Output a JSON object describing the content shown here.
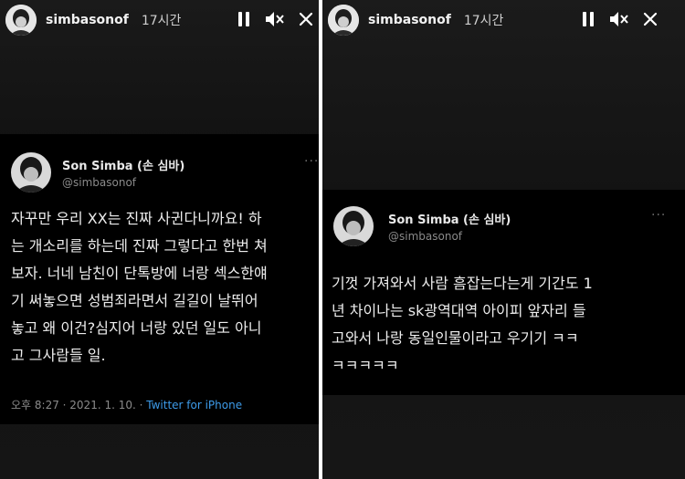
{
  "stories": [
    {
      "username": "simbasonof",
      "time_ago": "17시간",
      "tweet": {
        "display_name": "Son Simba (손 심바)",
        "handle": "@simbasonof",
        "more_label": "···",
        "lines": [
          "자꾸만 우리 XX는 진짜 사귄다니까요! 하",
          "는 개소리를 하는데 진짜 그렇다고 한번 쳐",
          "보자. 너네 남친이 단톡방에 너랑 섹스한얘",
          "기 써놓으면 성범죄라면서 길길이 날뛰어",
          "놓고 왜 이건?심지어 너랑 있던 일도 아니",
          "고 그사람들 일."
        ],
        "timestamp": "오후 8:27 · 2021. 1. 10. · ",
        "source": "Twitter for iPhone"
      }
    },
    {
      "username": "simbasonof",
      "time_ago": "17시간",
      "tweet": {
        "display_name": "Son Simba (손 심바)",
        "handle": "@simbasonof",
        "more_label": "···",
        "lines": [
          "기껏 가져와서 사람 흠잡는다는게 기간도 1",
          "년 차이나는 sk광역대역 아이피 앞자리 들",
          "고와서 나랑 동일인물이라고 우기기 ㅋㅋ",
          "ㅋㅋㅋㅋㅋ"
        ]
      }
    }
  ],
  "icons": {
    "pause": "pause-icon",
    "mute": "speaker-muted-icon",
    "more": "more-dots-icon"
  }
}
